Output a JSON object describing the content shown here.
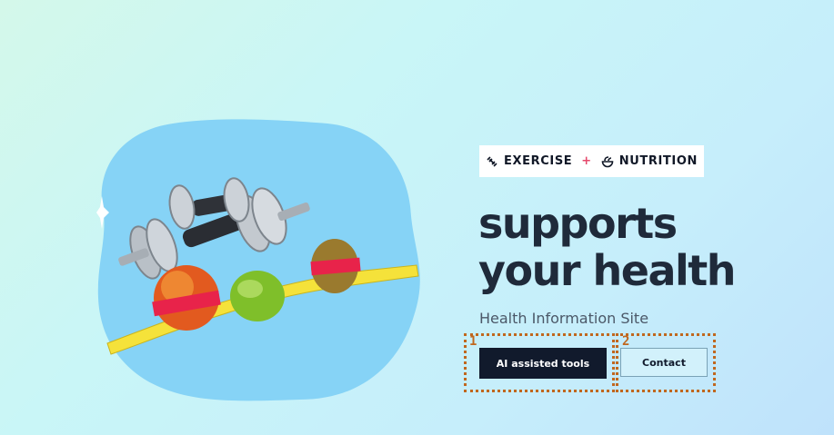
{
  "badge": {
    "exercise_icon": "dumbbell-icon",
    "exercise_label": "EXERCISE",
    "plus": "+",
    "nutrition_icon": "salad-bowl-icon",
    "nutrition_label": "NUTRITION",
    "plus_color": "#e5486b"
  },
  "hero": {
    "headline_line1": "supports",
    "headline_line2": "your health",
    "subtitle": "Health Information Site",
    "image_subject": "dumbbells-fruit-measuring-tape"
  },
  "actions": {
    "primary_label": "AI assisted tools",
    "secondary_label": "Contact"
  },
  "annotations": {
    "marker_1": "1",
    "marker_2": "2",
    "color": "#c0671e"
  }
}
